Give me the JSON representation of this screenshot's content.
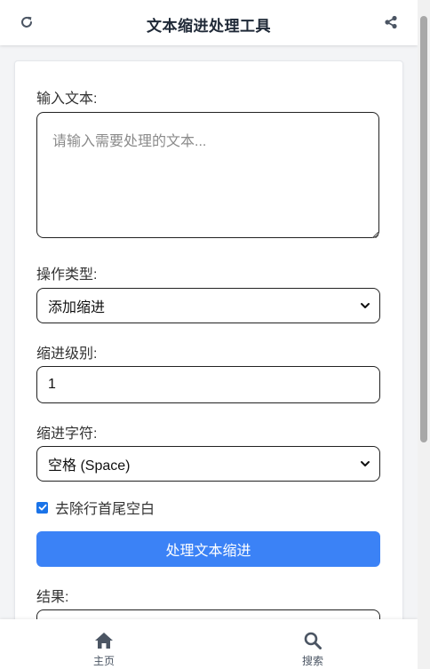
{
  "header": {
    "title": "文本缩进处理工具",
    "refresh_icon": "refresh-icon",
    "share_icon": "share-icon"
  },
  "form": {
    "input_label": "输入文本:",
    "input_placeholder": "请输入需要处理的文本...",
    "input_value": "",
    "operation_label": "操作类型:",
    "operation_selected": "添加缩进",
    "level_label": "缩进级别:",
    "level_value": "1",
    "char_label": "缩进字符:",
    "char_selected": "空格 (Space)",
    "trim_label": "去除行首尾空白",
    "trim_checked": true,
    "process_button": "处理文本缩进",
    "result_label": "结果:"
  },
  "bottom_nav": {
    "items": [
      {
        "label": "主页",
        "icon": "home-icon"
      },
      {
        "label": "搜索",
        "icon": "search-icon"
      }
    ]
  },
  "colors": {
    "primary": "#3b82f6",
    "checkbox": "#1a73e8",
    "icon": "#4b5563"
  }
}
